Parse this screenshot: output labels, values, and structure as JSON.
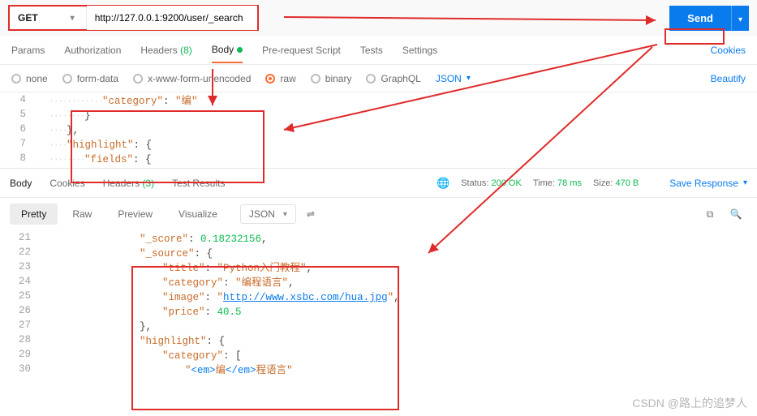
{
  "request": {
    "method": "GET",
    "url": "http://127.0.0.1:9200/user/_search",
    "send": "Send"
  },
  "tabs": {
    "params": "Params",
    "auth": "Authorization",
    "headers": "Headers",
    "headers_count": "(8)",
    "body": "Body",
    "prereq": "Pre-request Script",
    "tests": "Tests",
    "settings": "Settings",
    "cookies": "Cookies"
  },
  "body_types": {
    "none": "none",
    "formdata": "form-data",
    "xform": "x-www-form-urlencoded",
    "raw": "raw",
    "binary": "binary",
    "graphql": "GraphQL",
    "lang": "JSON",
    "beautify": "Beautify"
  },
  "req_editor": {
    "l4_no": "4",
    "l4_ws": "············",
    "l4_key": "\"category\"",
    "l4_sep": ": ",
    "l4_val": "\"编\"",
    "l5_no": "5",
    "l5_ws": "········",
    "l5_txt": "}",
    "l6_no": "6",
    "l6_ws": "····",
    "l6_txt": "},",
    "l7_no": "7",
    "l7_ws": "····",
    "l7_key": "\"highlight\"",
    "l7_sep": ": {",
    "l8_no": "8",
    "l8_ws": "········",
    "l8_key": "\"fields\"",
    "l8_sep": ": {"
  },
  "response_tabs": {
    "body": "Body",
    "cookies": "Cookies",
    "headers": "Headers",
    "headers_count": "(3)",
    "tests": "Test Results"
  },
  "status": {
    "label_status": "Status:",
    "code": "200 OK",
    "label_time": "Time:",
    "time": "78 ms",
    "label_size": "Size:",
    "size": "470 B",
    "save": "Save Response"
  },
  "view": {
    "pretty": "Pretty",
    "raw": "Raw",
    "preview": "Preview",
    "visualize": "Visualize",
    "lang": "JSON"
  },
  "resp_editor": {
    "r21_no": "21",
    "r21_key": "\"_score\"",
    "r21_val": "0.18232156",
    "r22_no": "22",
    "r22_key": "\"_source\"",
    "r23_no": "23",
    "r23_key": "\"title\"",
    "r23_val": "\"Python入门教程\"",
    "r24_no": "24",
    "r24_key": "\"category\"",
    "r24_val": "\"编程语言\"",
    "r25_no": "25",
    "r25_key": "\"image\"",
    "r25_q": "\"",
    "r25_url": "http://www.xsbc.com/hua.jpg",
    "r26_no": "26",
    "r26_key": "\"price\"",
    "r26_val": "40.5",
    "r27_no": "27",
    "r27_txt": "},",
    "r28_no": "28",
    "r28_key": "\"highlight\"",
    "r29_no": "29",
    "r29_key": "\"category\"",
    "r30_no": "30",
    "r30_q": "\"",
    "r30_t1": "<em>",
    "r30_v": "编",
    "r30_t2": "</em>",
    "r30_rest": "程语言\""
  },
  "watermark": "CSDN @路上的追梦人"
}
